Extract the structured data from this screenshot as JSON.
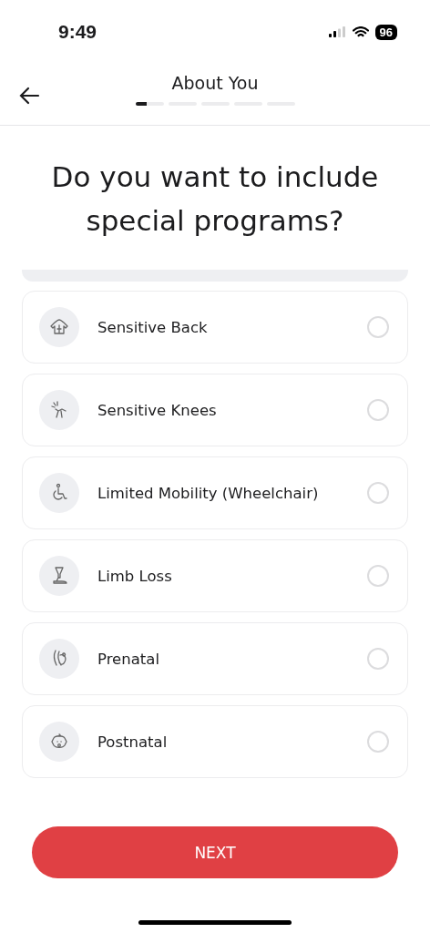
{
  "status_bar": {
    "time": "9:49",
    "battery": "96"
  },
  "header": {
    "title": "About You",
    "progress": [
      {
        "selected": true
      },
      {
        "selected": false
      },
      {
        "selected": false
      },
      {
        "selected": false
      },
      {
        "selected": false
      }
    ]
  },
  "question": "Do you want to include special programs?",
  "options": [
    {
      "label": "Sensitive Back",
      "selected": false
    },
    {
      "label": "Sensitive Knees",
      "selected": false
    },
    {
      "label": "Limited Mobility (Wheelchair)",
      "selected": false
    },
    {
      "label": "Limb Loss",
      "selected": false
    },
    {
      "label": "Prenatal",
      "selected": false
    },
    {
      "label": "Postnatal",
      "selected": false
    }
  ],
  "next_button": "NEXT"
}
